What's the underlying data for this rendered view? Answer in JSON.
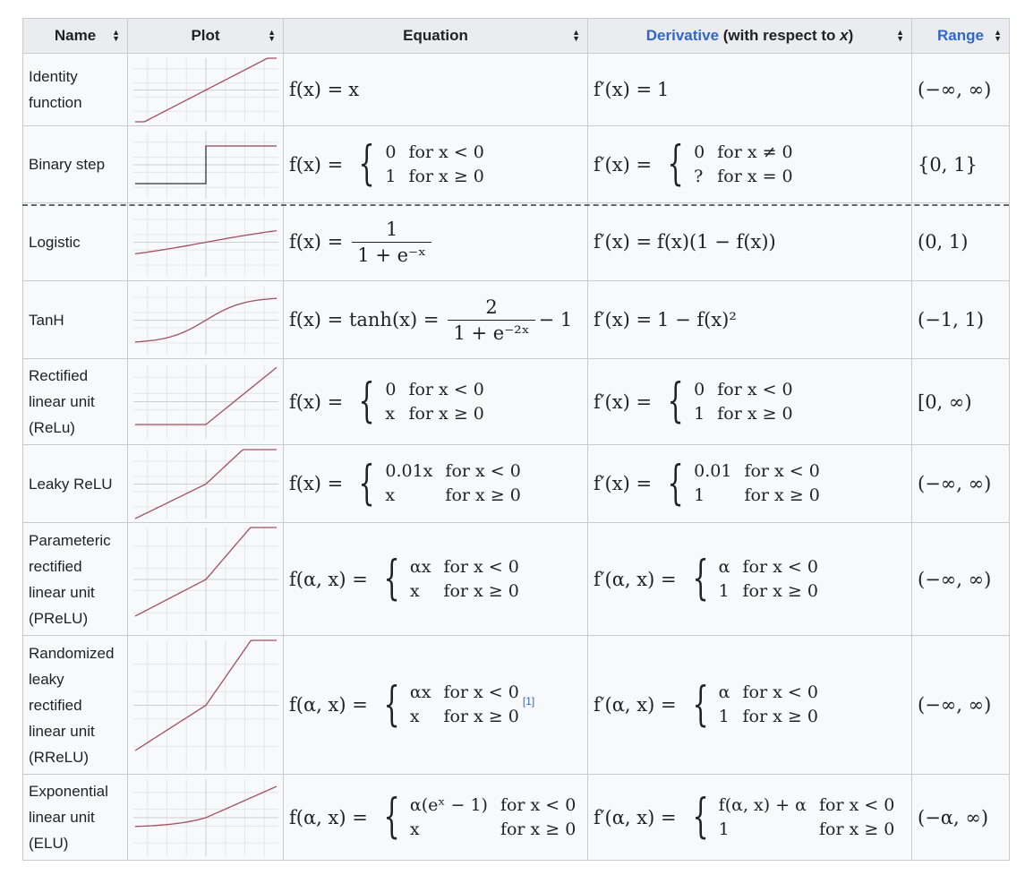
{
  "headers": {
    "name": "Name",
    "plot": "Plot",
    "equation": "Equation",
    "derivative_link": "Derivative",
    "derivative_rest": " (with respect to ",
    "derivative_var": "x",
    "derivative_close": ")",
    "range": "Range"
  },
  "rows": [
    {
      "name": [
        "Identity",
        "function"
      ],
      "eq_lhs": "f(x) =",
      "eq_text": "x",
      "der_lhs": "f′(x) =",
      "der_text": "1",
      "range": "(−∞, ∞)"
    },
    {
      "name": [
        "Binary step"
      ],
      "eq_lhs": "f(x) =",
      "eq_cases": [
        [
          "0",
          "for x < 0"
        ],
        [
          "1",
          "for x ≥ 0"
        ]
      ],
      "der_lhs": "f′(x) =",
      "der_cases": [
        [
          "0",
          "for x ≠ 0"
        ],
        [
          "?",
          "for x = 0"
        ]
      ],
      "range": "{0, 1}"
    },
    {
      "name": [
        "Logistic"
      ],
      "eq_lhs": "f(x) =",
      "eq_num": "1",
      "eq_den": "1 + e⁻ˣ",
      "der_lhs": "f′(x) =",
      "der_text": "f(x)(1 − f(x))",
      "range": "(0, 1)"
    },
    {
      "name": [
        "TanH"
      ],
      "eq_lhs": "f(x) = tanh(x) =",
      "eq_num": "2",
      "eq_den": "1 + e⁻²ˣ",
      "eq_tail": "− 1",
      "der_lhs": "f′(x) =",
      "der_text": "1 − f(x)²",
      "range": "(−1, 1)"
    },
    {
      "name": [
        "Rectified",
        "linear unit",
        "(ReLu)"
      ],
      "eq_lhs": "f(x) =",
      "eq_cases": [
        [
          "0",
          "for x < 0"
        ],
        [
          "x",
          "for x ≥ 0"
        ]
      ],
      "der_lhs": "f′(x) =",
      "der_cases": [
        [
          "0",
          "for x < 0"
        ],
        [
          "1",
          "for x ≥ 0"
        ]
      ],
      "range": "[0, ∞)"
    },
    {
      "name": [
        "Leaky ReLU"
      ],
      "eq_lhs": "f(x) =",
      "eq_cases": [
        [
          "0.01x",
          "for x < 0"
        ],
        [
          "x",
          "for x ≥ 0"
        ]
      ],
      "der_lhs": "f′(x) =",
      "der_cases": [
        [
          "0.01",
          "for x < 0"
        ],
        [
          "1",
          "for x ≥ 0"
        ]
      ],
      "range": "(−∞, ∞)"
    },
    {
      "name": [
        "Parameteric",
        "rectified",
        "linear unit",
        "(PReLU)"
      ],
      "eq_lhs": "f(α, x) =",
      "eq_cases": [
        [
          "αx",
          "for x < 0"
        ],
        [
          "x",
          "for x ≥ 0"
        ]
      ],
      "der_lhs": "f′(α, x) =",
      "der_cases": [
        [
          "α",
          "for x < 0"
        ],
        [
          "1",
          "for x ≥ 0"
        ]
      ],
      "range": "(−∞, ∞)"
    },
    {
      "name": [
        "Randomized",
        "leaky",
        "rectified",
        "linear unit",
        "(RReLU)"
      ],
      "eq_lhs": "f(α, x) =",
      "eq_cases": [
        [
          "αx",
          "for x < 0"
        ],
        [
          "x",
          "for x ≥ 0"
        ]
      ],
      "eq_ref": "[1]",
      "der_lhs": "f′(α, x) =",
      "der_cases": [
        [
          "α",
          "for x < 0"
        ],
        [
          "1",
          "for x ≥ 0"
        ]
      ],
      "range": "(−∞, ∞)"
    },
    {
      "name": [
        "Exponential",
        "linear unit",
        "(ELU)"
      ],
      "eq_lhs": "f(α, x) =",
      "eq_cases": [
        [
          "α(eˣ − 1)",
          "for x < 0"
        ],
        [
          "x",
          "for x ≥ 0"
        ]
      ],
      "der_lhs": "f′(α, x) =",
      "der_cases": [
        [
          "f(α, x) + α",
          "for x < 0"
        ],
        [
          "1",
          "for x ≥ 0"
        ]
      ],
      "range": "(−α, ∞)"
    }
  ],
  "colors": {
    "header_bg": "#eaecf0",
    "cell_bg": "#f8f9fa",
    "border": "#c8ccd1",
    "link": "#3366cc",
    "curve": "#a05060"
  }
}
